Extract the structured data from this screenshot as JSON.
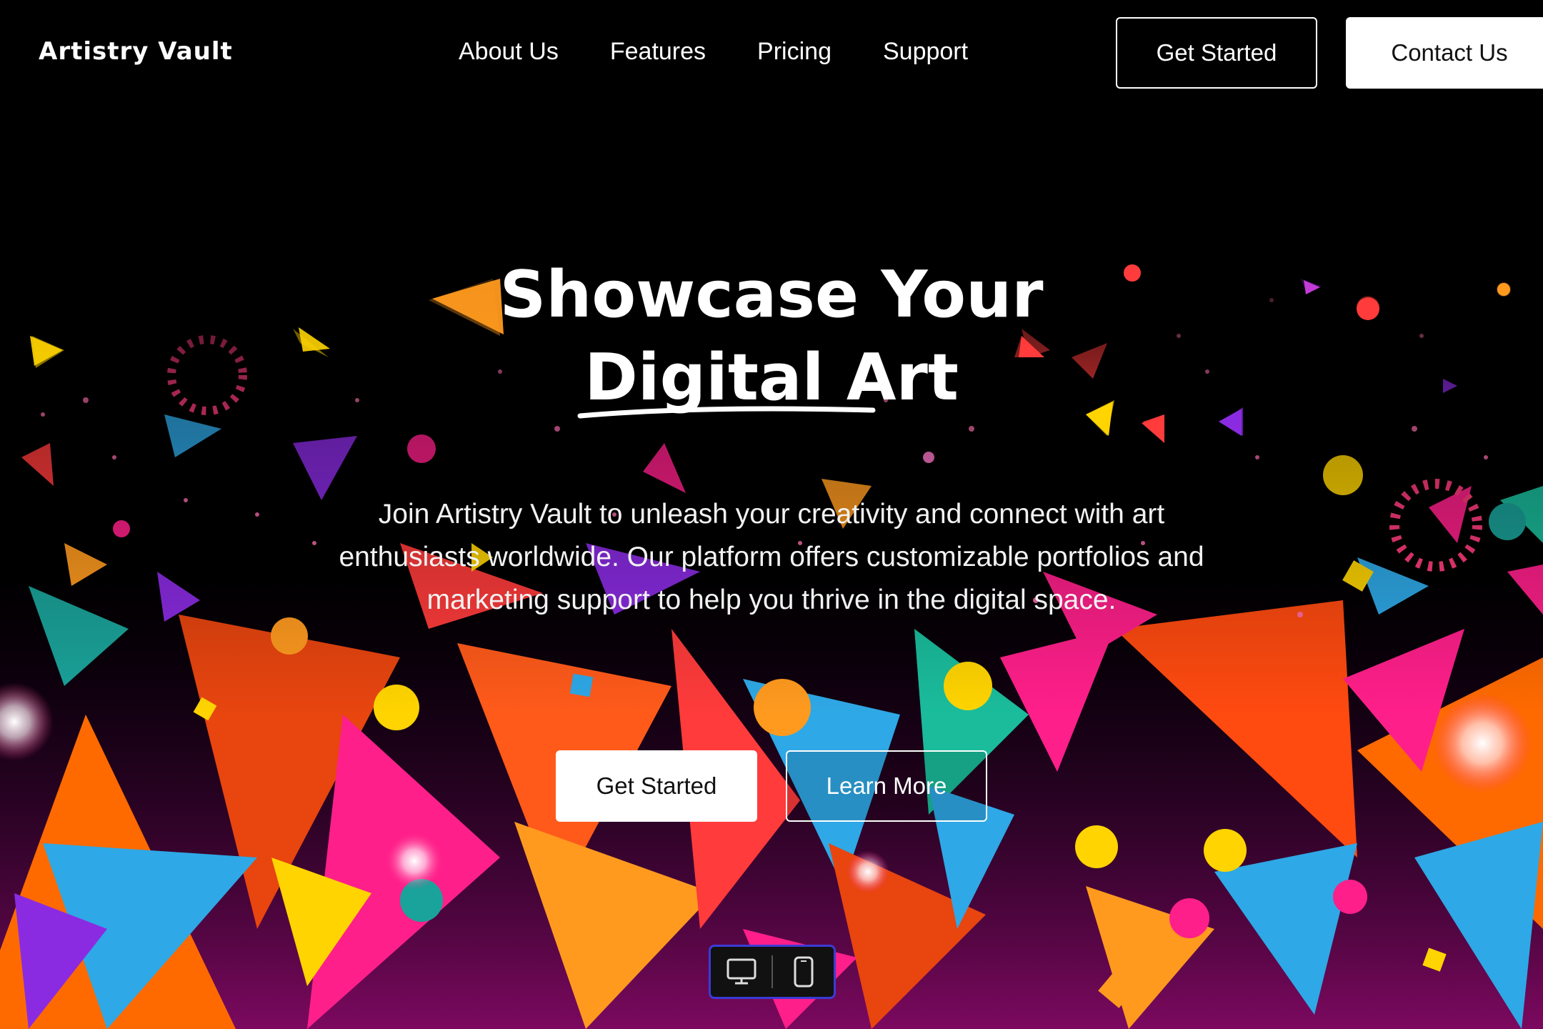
{
  "header": {
    "logo": "Artistry Vault",
    "nav": [
      "About Us",
      "Features",
      "Pricing",
      "Support"
    ],
    "get_started": "Get Started",
    "contact": "Contact Us"
  },
  "hero": {
    "title_line1": "Showcase Your",
    "title_line2": "Digital Art",
    "description": "Join Artistry Vault to unleash your creativity and connect with art enthusiasts worldwide. Our platform offers customizable portfolios and marketing support to help you thrive in the digital space.",
    "primary_button": "Get Started",
    "secondary_button": "Learn More"
  },
  "device_toggle": {
    "options": [
      "desktop-icon",
      "mobile-icon"
    ],
    "accent_color": "#3b3bd6"
  },
  "colors": {
    "background": "#000000",
    "text": "#ffffff",
    "confetti": [
      "#ff6a00",
      "#ff1f8a",
      "#2ea8e6",
      "#ffd400",
      "#8a2be2",
      "#ff3b3b",
      "#1abc9c",
      "#ff9a1f"
    ]
  }
}
